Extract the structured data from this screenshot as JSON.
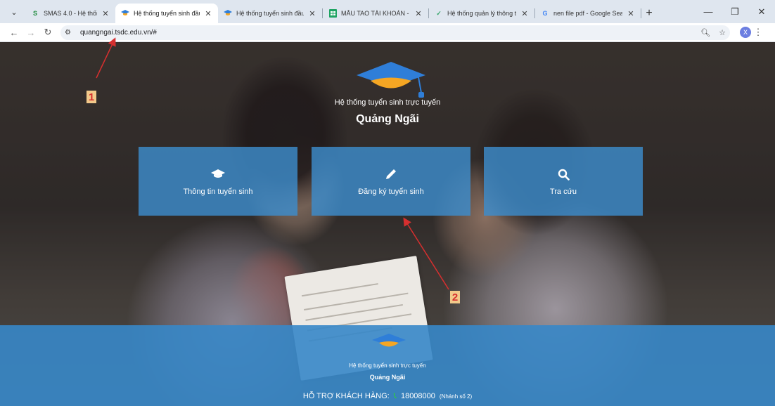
{
  "browser": {
    "tabs": [
      {
        "title": "SMAS 4.0 - Hệ thống quản",
        "favicon": "smas-icon",
        "active": false
      },
      {
        "title": "Hệ thống tuyển sinh đầu c",
        "favicon": "graduation-cap-icon",
        "active": true
      },
      {
        "title": "Hệ thống tuyển sinh đầu c",
        "favicon": "graduation-cap-icon",
        "active": false
      },
      {
        "title": "MẪU TAO TÀI KHOẢN - M",
        "favicon": "sheets-icon",
        "active": false
      },
      {
        "title": "Hệ thống quản lý thông tin",
        "favicon": "app-icon",
        "active": false
      },
      {
        "title": "nen file pdf - Google Sear",
        "favicon": "google-icon",
        "active": false
      }
    ],
    "url": "quangngai.tsdc.edu.vn/#",
    "profile_initial": "X"
  },
  "hero": {
    "subtitle": "Hệ thống tuyển sinh trực tuyến",
    "title": "Quảng Ngãi"
  },
  "tiles": [
    {
      "label": "Thông tin tuyển sinh",
      "icon": "graduation-cap-icon"
    },
    {
      "label": "Đăng ký tuyển sinh",
      "icon": "pencil-icon"
    },
    {
      "label": "Tra cứu",
      "icon": "search-icon"
    }
  ],
  "footer": {
    "subtitle": "Hệ thống tuyển sinh trực tuyến",
    "title": "Quảng Ngãi",
    "support_label": "HỖ TRỢ KHÁCH HÀNG:",
    "phone": "18008000",
    "branch": "(Nhánh số 2)"
  },
  "annotations": [
    {
      "number": "1"
    },
    {
      "number": "2"
    }
  ],
  "colors": {
    "tile_bg": "#3d8ccc",
    "cap_blue": "#2f7ed8",
    "cap_orange": "#f5a623",
    "annotation_red": "#d62f2f"
  }
}
